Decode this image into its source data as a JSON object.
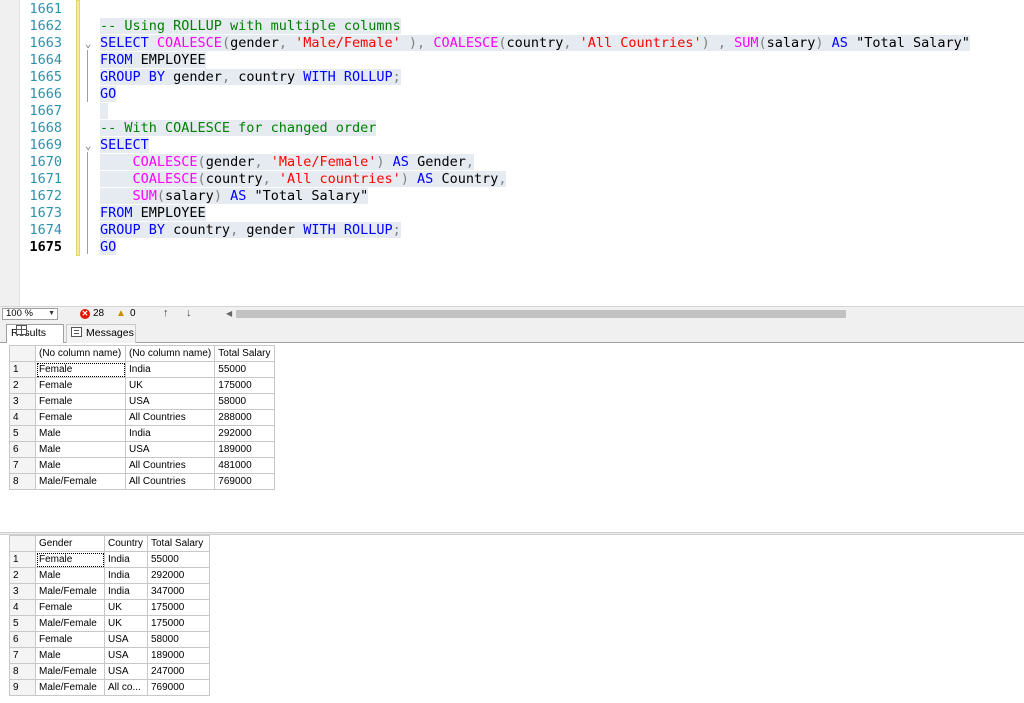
{
  "editor": {
    "lines": [
      {
        "num": "1661",
        "segments": []
      },
      {
        "num": "1662",
        "segments": [
          {
            "t": "-- Using ROLLUP with multiple columns",
            "c": "cm"
          }
        ]
      },
      {
        "num": "1663",
        "fold": "⌄",
        "segments": [
          {
            "t": "SELECT ",
            "c": "kw"
          },
          {
            "t": "COALESCE",
            "c": "fn"
          },
          {
            "t": "(",
            "c": "gr"
          },
          {
            "t": "gender",
            "c": "id"
          },
          {
            "t": ", ",
            "c": "gr"
          },
          {
            "t": "'Male/Female'",
            "c": "str"
          },
          {
            "t": " ), ",
            "c": "gr"
          },
          {
            "t": "COALESCE",
            "c": "fn"
          },
          {
            "t": "(",
            "c": "gr"
          },
          {
            "t": "country",
            "c": "id"
          },
          {
            "t": ", ",
            "c": "gr"
          },
          {
            "t": "'All Countries'",
            "c": "str"
          },
          {
            "t": ") , ",
            "c": "gr"
          },
          {
            "t": "SUM",
            "c": "fn"
          },
          {
            "t": "(",
            "c": "gr"
          },
          {
            "t": "salary",
            "c": "id"
          },
          {
            "t": ") ",
            "c": "gr"
          },
          {
            "t": "AS",
            "c": "kw"
          },
          {
            "t": " \"Total Salary\"",
            "c": "id"
          }
        ]
      },
      {
        "num": "1664",
        "segments": [
          {
            "t": "FROM ",
            "c": "kw"
          },
          {
            "t": "EMPLOYEE",
            "c": "id"
          }
        ]
      },
      {
        "num": "1665",
        "segments": [
          {
            "t": "GROUP BY ",
            "c": "kw"
          },
          {
            "t": "gender",
            "c": "id"
          },
          {
            "t": ", ",
            "c": "gr"
          },
          {
            "t": "country ",
            "c": "id"
          },
          {
            "t": "WITH ROLLUP",
            "c": "kw"
          },
          {
            "t": ";",
            "c": "gr"
          }
        ]
      },
      {
        "num": "1666",
        "segments": [
          {
            "t": "GO",
            "c": "kw"
          }
        ]
      },
      {
        "num": "1667",
        "segments": [
          {
            "t": " ",
            "c": "id"
          }
        ]
      },
      {
        "num": "1668",
        "segments": [
          {
            "t": "-- With COALESCE for changed order",
            "c": "cm"
          }
        ]
      },
      {
        "num": "1669",
        "fold": "⌄",
        "segments": [
          {
            "t": "SELECT",
            "c": "kw"
          }
        ]
      },
      {
        "num": "1670",
        "segments": [
          {
            "t": "    ",
            "c": "id"
          },
          {
            "t": "COALESCE",
            "c": "fn"
          },
          {
            "t": "(",
            "c": "gr"
          },
          {
            "t": "gender",
            "c": "id"
          },
          {
            "t": ", ",
            "c": "gr"
          },
          {
            "t": "'Male/Female'",
            "c": "str"
          },
          {
            "t": ") ",
            "c": "gr"
          },
          {
            "t": "AS",
            "c": "kw"
          },
          {
            "t": " Gender",
            "c": "id"
          },
          {
            "t": ",",
            "c": "gr"
          }
        ]
      },
      {
        "num": "1671",
        "segments": [
          {
            "t": "    ",
            "c": "id"
          },
          {
            "t": "COALESCE",
            "c": "fn"
          },
          {
            "t": "(",
            "c": "gr"
          },
          {
            "t": "country",
            "c": "id"
          },
          {
            "t": ", ",
            "c": "gr"
          },
          {
            "t": "'All countries'",
            "c": "str"
          },
          {
            "t": ") ",
            "c": "gr"
          },
          {
            "t": "AS",
            "c": "kw"
          },
          {
            "t": " Country",
            "c": "id"
          },
          {
            "t": ",",
            "c": "gr"
          }
        ]
      },
      {
        "num": "1672",
        "segments": [
          {
            "t": "    ",
            "c": "id"
          },
          {
            "t": "SUM",
            "c": "fn"
          },
          {
            "t": "(",
            "c": "gr"
          },
          {
            "t": "salary",
            "c": "id"
          },
          {
            "t": ") ",
            "c": "gr"
          },
          {
            "t": "AS",
            "c": "kw"
          },
          {
            "t": " \"Total Salary\"",
            "c": "id"
          }
        ]
      },
      {
        "num": "1673",
        "segments": [
          {
            "t": "FROM ",
            "c": "kw"
          },
          {
            "t": "EMPLOYEE",
            "c": "id"
          }
        ]
      },
      {
        "num": "1674",
        "segments": [
          {
            "t": "GROUP BY ",
            "c": "kw"
          },
          {
            "t": "country",
            "c": "id"
          },
          {
            "t": ", ",
            "c": "gr"
          },
          {
            "t": "gender ",
            "c": "id"
          },
          {
            "t": "WITH ROLLUP",
            "c": "kw"
          },
          {
            "t": ";",
            "c": "gr"
          }
        ]
      },
      {
        "num": "1675",
        "current": true,
        "segments": [
          {
            "t": "GO",
            "c": "kw"
          }
        ]
      }
    ]
  },
  "status": {
    "zoom": "100 %",
    "errors": "28",
    "warnings": "0"
  },
  "tabs": {
    "results_label": "Results",
    "messages_label": "Messages"
  },
  "grid1": {
    "headers": [
      "(No column name)",
      "(No column name)",
      "Total Salary"
    ],
    "rows": [
      [
        "1",
        "Female",
        "India",
        "55000"
      ],
      [
        "2",
        "Female",
        "UK",
        "175000"
      ],
      [
        "3",
        "Female",
        "USA",
        "58000"
      ],
      [
        "4",
        "Female",
        "All Countries",
        "288000"
      ],
      [
        "5",
        "Male",
        "India",
        "292000"
      ],
      [
        "6",
        "Male",
        "USA",
        "189000"
      ],
      [
        "7",
        "Male",
        "All Countries",
        "481000"
      ],
      [
        "8",
        "Male/Female",
        "All Countries",
        "769000"
      ]
    ]
  },
  "grid2": {
    "headers": [
      "Gender",
      "Country",
      "Total Salary"
    ],
    "rows": [
      [
        "1",
        "Female",
        "India",
        "55000"
      ],
      [
        "2",
        "Male",
        "India",
        "292000"
      ],
      [
        "3",
        "Male/Female",
        "India",
        "347000"
      ],
      [
        "4",
        "Female",
        "UK",
        "175000"
      ],
      [
        "5",
        "Male/Female",
        "UK",
        "175000"
      ],
      [
        "6",
        "Female",
        "USA",
        "58000"
      ],
      [
        "7",
        "Male",
        "USA",
        "189000"
      ],
      [
        "8",
        "Male/Female",
        "USA",
        "247000"
      ],
      [
        "9",
        "Male/Female",
        "All co...",
        "769000"
      ]
    ]
  }
}
